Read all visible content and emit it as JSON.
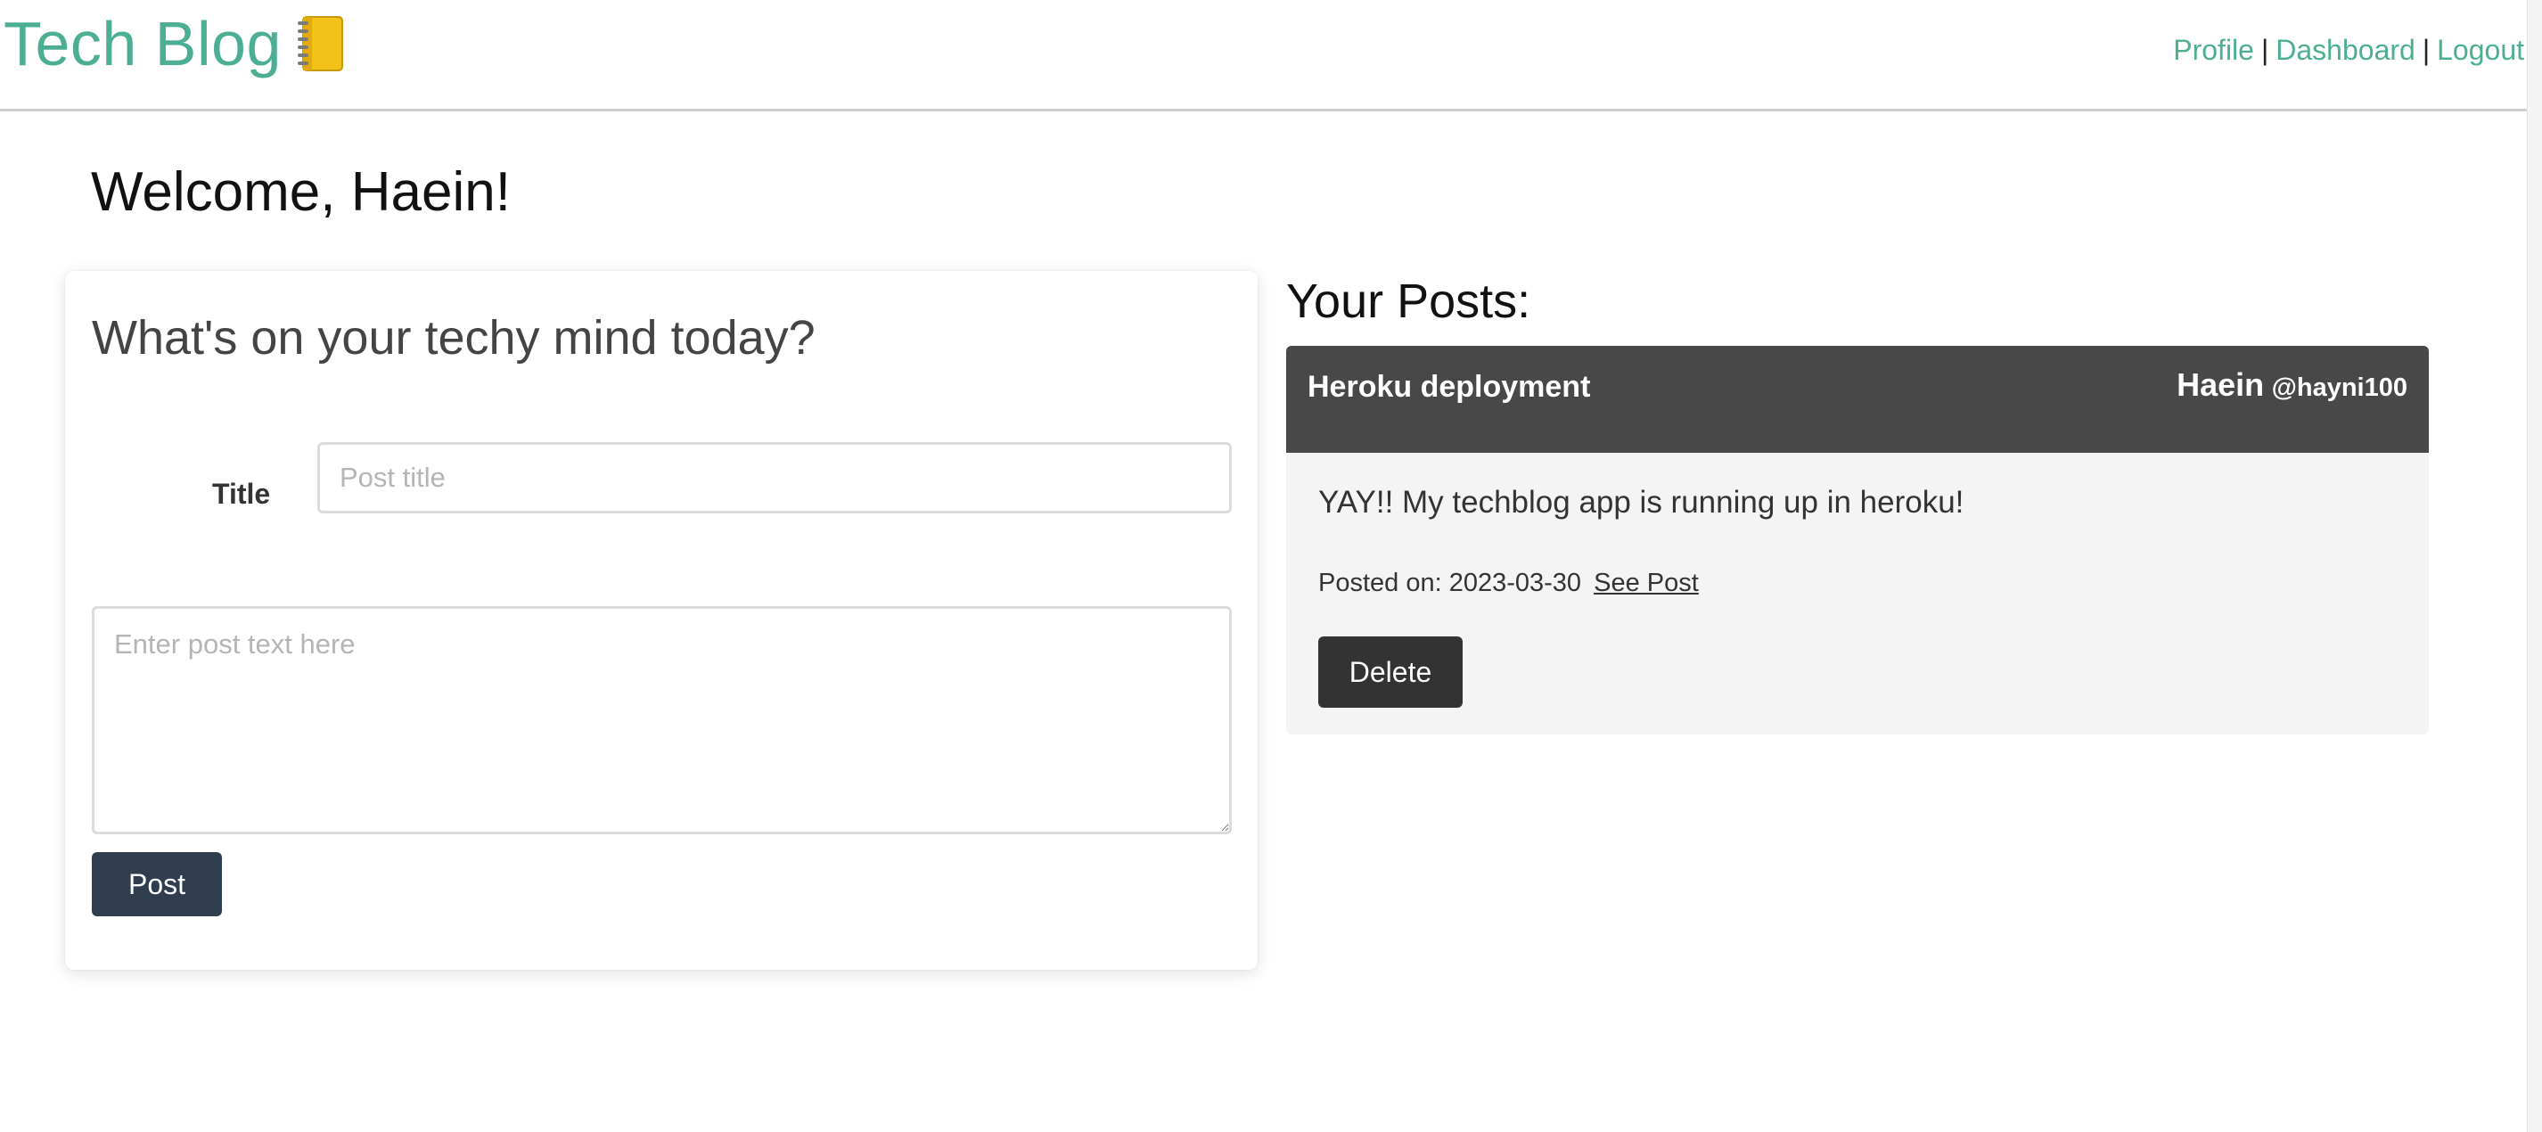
{
  "header": {
    "brand_title": "Tech Blog",
    "brand_icon": "notebook-icon",
    "nav": {
      "profile_label": "Profile",
      "dashboard_label": "Dashboard",
      "logout_label": "Logout",
      "separator": "|"
    }
  },
  "welcome_text": "Welcome, Haein!",
  "compose": {
    "heading": "What's on your techy mind today?",
    "title_label": "Title",
    "title_placeholder": "Post title",
    "body_placeholder": "Enter post text here",
    "post_button_label": "Post"
  },
  "your_posts": {
    "heading": "Your Posts:",
    "posts": [
      {
        "title": "Heroku deployment",
        "author_name": "Haein",
        "author_handle": "@hayni100",
        "body": "YAY!! My techblog app is running up in heroku!",
        "posted_on_label": "Posted on: 2023-03-30",
        "see_post_label": "See Post",
        "delete_label": "Delete"
      }
    ]
  },
  "colors": {
    "brand_green": "#4caf94",
    "post_button": "#2f3d4e",
    "post_card_header": "#484848",
    "post_card_body": "#f4f4f4",
    "delete_button": "#333333"
  }
}
